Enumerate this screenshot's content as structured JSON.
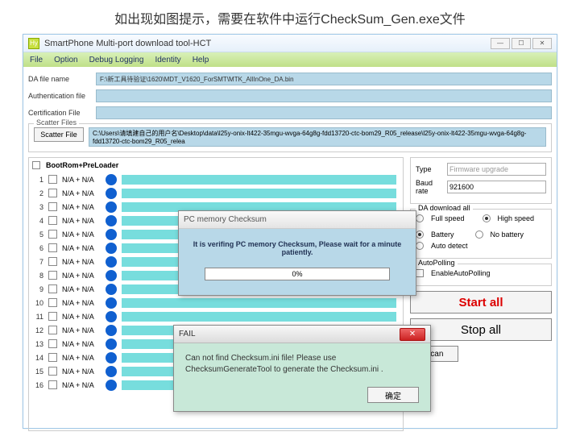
{
  "caption": "如出现如图提示，需要在软件中运行CheckSum_Gen.exe文件",
  "window": {
    "title": "SmartPhone Multi-port download tool-HCT",
    "icon_label": "Hy"
  },
  "menu": [
    "File",
    "Option",
    "Debug Logging",
    "Identity",
    "Help"
  ],
  "files": {
    "da_label": "DA file name",
    "da_value": "F:\\新工具待验证\\1620\\MDT_V1620_ForSMT\\MTK_AllInOne_DA.bin",
    "auth_label": "Authentication file",
    "auth_value": "",
    "cert_label": "Certification File",
    "cert_value": ""
  },
  "scatter": {
    "legend": "Scatter Files",
    "button": "Scatter File",
    "path": "C:\\Users\\请填建自己的用户名\\Desktop\\data\\l25y-onix-lt422-35mgu-wvga-64g8g-fdd13720-ctc-bom29_R05_release\\l25y-onix-lt422-35mgu-wvga-64g8g-fdd13720-ctc-bom29_R05_relea"
  },
  "bootrom_label": "BootRom+PreLoader",
  "ports": [
    {
      "n": "1",
      "v": "N/A + N/A"
    },
    {
      "n": "2",
      "v": "N/A + N/A"
    },
    {
      "n": "3",
      "v": "N/A + N/A"
    },
    {
      "n": "4",
      "v": "N/A + N/A"
    },
    {
      "n": "5",
      "v": "N/A + N/A"
    },
    {
      "n": "6",
      "v": "N/A + N/A"
    },
    {
      "n": "7",
      "v": "N/A + N/A"
    },
    {
      "n": "8",
      "v": "N/A + N/A"
    },
    {
      "n": "9",
      "v": "N/A + N/A"
    },
    {
      "n": "10",
      "v": "N/A + N/A"
    },
    {
      "n": "11",
      "v": "N/A + N/A"
    },
    {
      "n": "12",
      "v": "N/A + N/A"
    },
    {
      "n": "13",
      "v": "N/A + N/A"
    },
    {
      "n": "14",
      "v": "N/A + N/A"
    },
    {
      "n": "15",
      "v": "N/A + N/A"
    },
    {
      "n": "16",
      "v": "N/A + N/A"
    }
  ],
  "side": {
    "type_label": "Type",
    "type_value": "Firmware upgrade",
    "baud_label": "Baud rate",
    "baud_value": "921600",
    "da_legend": "DA download all",
    "full_speed": "Full speed",
    "high_speed": "High speed",
    "battery": "Battery",
    "no_battery": "No battery",
    "auto_detect": "Auto detect",
    "autopoll_legend": "AutoPolling",
    "autopoll": "EnableAutoPolling",
    "start": "Start all",
    "stop": "Stop all",
    "scan": "Scan"
  },
  "dlg1": {
    "title": "PC memory Checksum",
    "msg": "It is verifing PC memory Checksum, Please wait for a minute  patiently.",
    "progress": "0%"
  },
  "dlg2": {
    "title": "FAIL",
    "msg": "Can not find Checksum.ini file! Please use ChecksumGenerateTool to generate the Checksum.ini .",
    "ok": "确定"
  }
}
